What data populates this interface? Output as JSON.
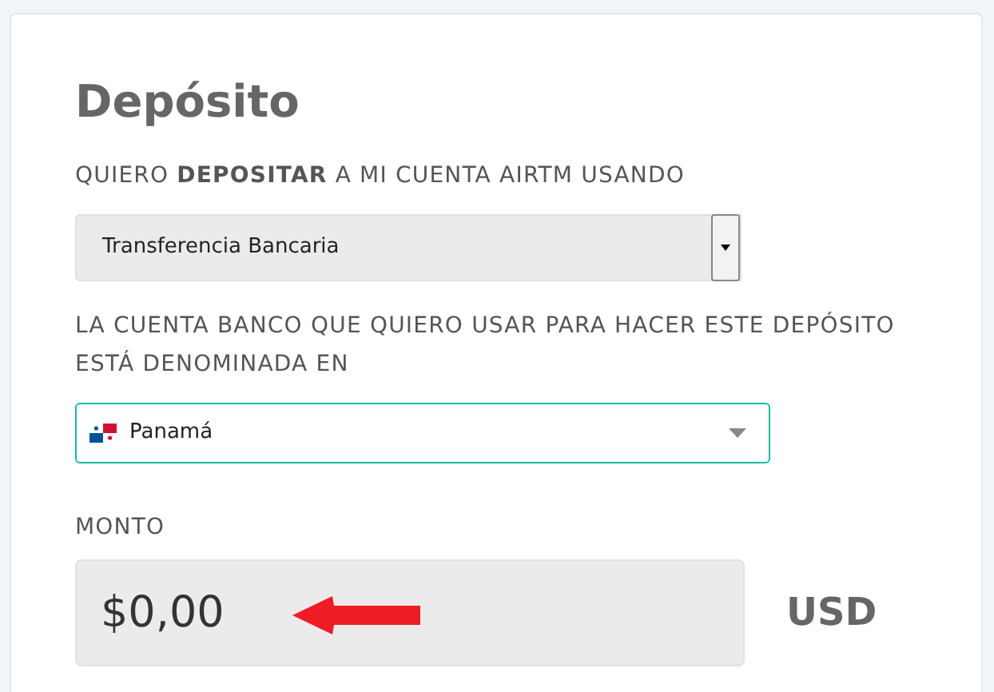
{
  "title": "Depósito",
  "method_label": "QUIERO **DEPOSITAR** A MI CUENTA AIRTM USANDO",
  "method_select": {
    "value": "Transferencia Bancaria"
  },
  "currency_label": "LA CUENTA BANCO QUE QUIERO USAR PARA HACER ESTE DEPÓSITO ESTÁ DENOMINADA EN",
  "country_select": {
    "value": "Panamá",
    "focused": true
  },
  "amount_label": "MONTO",
  "amount_field": {
    "value": "$0,00"
  },
  "currency": "USD"
}
